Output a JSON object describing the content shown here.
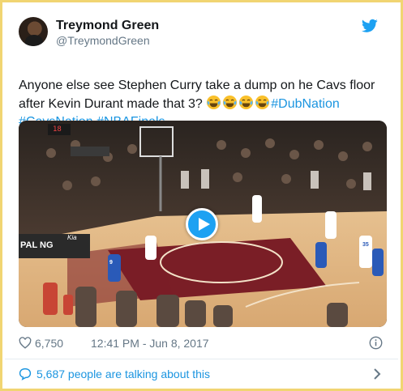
{
  "user": {
    "name": "Treymond Green",
    "handle": "@TreymondGreen"
  },
  "tweet": {
    "text": "Anyone else see Stephen Curry take a dump on he Cavs floor after Kevin Durant made that 3?",
    "emoji_count": 4,
    "hashtags": [
      "#DubNation",
      "#CavsNation",
      "#NBAFinals"
    ]
  },
  "media": {
    "type": "video",
    "scoreboard": "18",
    "court_text_left": "PAL NG",
    "court_text_sponsor": "Kia",
    "player_numbers": [
      "9",
      "35"
    ]
  },
  "meta": {
    "likes": "6,750",
    "time": "12:41 PM - Jun 8, 2017"
  },
  "footer": {
    "talking": "5,687 people are talking about this"
  },
  "colors": {
    "accent": "#1b95e0",
    "frame": "#f1d572",
    "muted": "#657786"
  }
}
